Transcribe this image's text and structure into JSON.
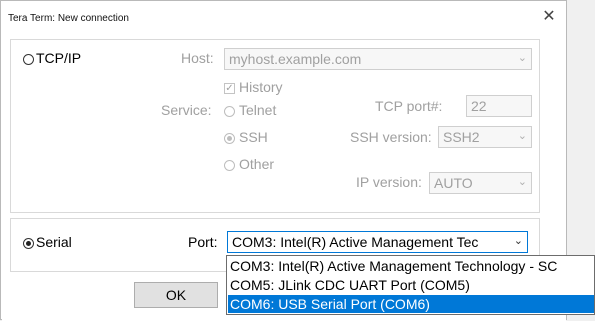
{
  "window": {
    "title": "Tera Term: New connection",
    "close_glyph": "✕"
  },
  "tcpip": {
    "radio_label": "TCP/IP",
    "host_label": "Host:",
    "host_value": "myhost.example.com",
    "history_label": "History",
    "service_label": "Service:",
    "telnet_label": "Telnet",
    "ssh_label": "SSH",
    "other_label": "Other",
    "tcp_port_label": "TCP port#:",
    "tcp_port_value": "22",
    "ssh_version_label": "SSH version:",
    "ssh_version_value": "SSH2",
    "ip_version_label": "IP version:",
    "ip_version_value": "AUTO"
  },
  "serial": {
    "radio_label": "Serial",
    "port_label": "Port:",
    "port_value": "COM3: Intel(R) Active Management Tec",
    "options": [
      "COM3: Intel(R) Active Management Technology - SC",
      "COM5: JLink CDC UART Port (COM5)",
      "COM6: USB Serial Port (COM6)"
    ],
    "selected_index": 2
  },
  "buttons": {
    "ok_label": "OK"
  },
  "colors": {
    "selection": "#0078d7",
    "disabled_text": "#a0a0a0"
  }
}
